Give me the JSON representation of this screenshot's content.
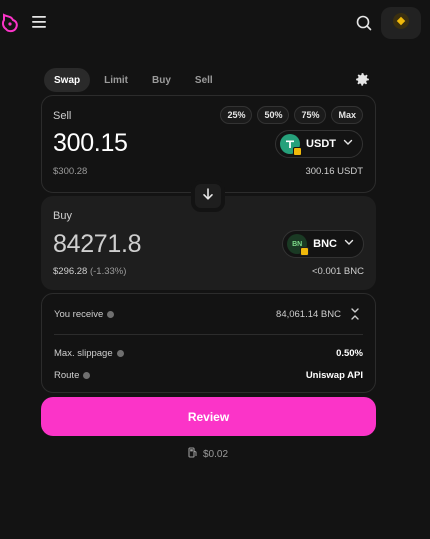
{
  "header": {
    "logo_icon": "unicorn-logo-icon",
    "menu_icon": "hamburger-menu-icon",
    "search_icon": "search-icon",
    "wallet_icon": "bnb-wallet-icon"
  },
  "tabs": [
    {
      "label": "Swap",
      "active": true
    },
    {
      "label": "Limit",
      "active": false
    },
    {
      "label": "Buy",
      "active": false
    },
    {
      "label": "Sell",
      "active": false
    }
  ],
  "sell": {
    "label": "Sell",
    "amount": "300.15",
    "usd_value": "$300.28",
    "balance": "300.16 USDT",
    "token_symbol": "USDT",
    "percent_buttons": [
      "25%",
      "50%",
      "75%",
      "Max"
    ]
  },
  "buy": {
    "label": "Buy",
    "amount": "84271.8",
    "usd_value": "$296.28",
    "usd_change": "(-1.33%)",
    "balance": "<0.001 BNC",
    "token_symbol": "BNC",
    "token_glyph": "BN"
  },
  "details": {
    "receive_label": "You receive",
    "receive_value": "84,061.14 BNC",
    "slippage_label": "Max. slippage",
    "slippage_value": "0.50%",
    "route_label": "Route",
    "route_value": "Uniswap API"
  },
  "review_label": "Review",
  "network_fee": "$0.02",
  "colors": {
    "background": "#131313",
    "accent": "#fb34c8",
    "usdt": "#26a17b",
    "bnc": "#1a3a24",
    "bnb": "#f0b90b"
  }
}
